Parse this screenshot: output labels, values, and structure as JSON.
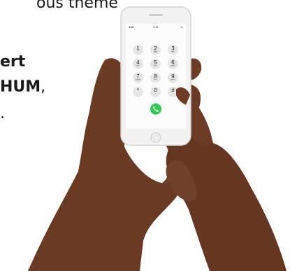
{
  "background_text": {
    "line1": "ous theme",
    "line2": "ert",
    "line3": "HUM",
    "line3_suffix": ",",
    "line4": "."
  },
  "phone": {
    "status": {
      "time": "9:41"
    },
    "keys": [
      {
        "digit": "1",
        "letters": ""
      },
      {
        "digit": "2",
        "letters": "ABC"
      },
      {
        "digit": "3",
        "letters": "DEF"
      },
      {
        "digit": "4",
        "letters": "GHI"
      },
      {
        "digit": "5",
        "letters": "JKL"
      },
      {
        "digit": "6",
        "letters": "MNO"
      },
      {
        "digit": "7",
        "letters": "PQRS"
      },
      {
        "digit": "8",
        "letters": "TUV"
      },
      {
        "digit": "9",
        "letters": "WXYZ"
      },
      {
        "digit": "*",
        "letters": ""
      },
      {
        "digit": "0",
        "letters": "+"
      },
      {
        "digit": "#",
        "letters": ""
      }
    ],
    "call_color": "#34c759",
    "skin_color": "#6b3a22"
  }
}
